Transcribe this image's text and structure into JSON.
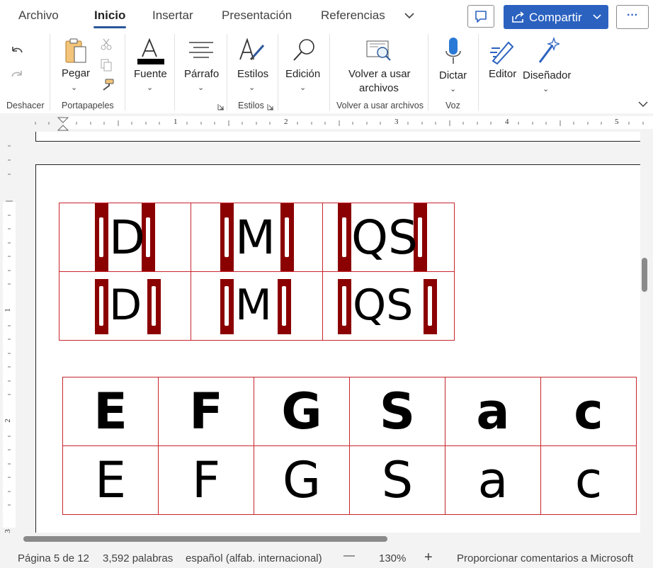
{
  "tabs": [
    "Archivo",
    "Inicio",
    "Insertar",
    "Presentación",
    "Referencias"
  ],
  "share_label": "Compartir",
  "more_label": "···",
  "ribbon": {
    "undo_group": "Deshacer",
    "paste_label": "Pegar",
    "clipboard_group": "Portapapeles",
    "font_label": "Fuente",
    "paragraph_label": "Párrafo",
    "styles_label": "Estilos",
    "styles_group": "Estilos",
    "editing_label": "Edición",
    "reuse_label_line1": "Volver a usar",
    "reuse_label_line2": "archivos",
    "reuse_group": "Volver a usar archivos",
    "dictate_label": "Dictar",
    "voice_group": "Voz",
    "editor_label": "Editor",
    "designer_label": "Diseñador"
  },
  "ruler": {
    "h": [
      "1",
      "2",
      "3",
      "4",
      "5"
    ],
    "v": [
      "1",
      "2",
      "3"
    ]
  },
  "document": {
    "table1": [
      [
        "D",
        "M",
        "QS"
      ],
      [
        "D",
        "M",
        "QS"
      ]
    ],
    "table2": [
      [
        "E",
        "F",
        "G",
        "S",
        "a",
        "c"
      ],
      [
        "E",
        "F",
        "G",
        "S",
        "a",
        "c"
      ]
    ]
  },
  "status": {
    "page": "Página 5 de 12",
    "words": "3,592 palabras",
    "language": "español (alfab. internacional)",
    "zoom_out": "—",
    "zoom": "130%",
    "zoom_in": "+",
    "feedback": "Proporcionar comentarios a Microsoft"
  },
  "colors": {
    "accent": "#2b579a",
    "share": "#2b62c0",
    "table_border": "#c8252d",
    "bar": "#8b0000"
  }
}
